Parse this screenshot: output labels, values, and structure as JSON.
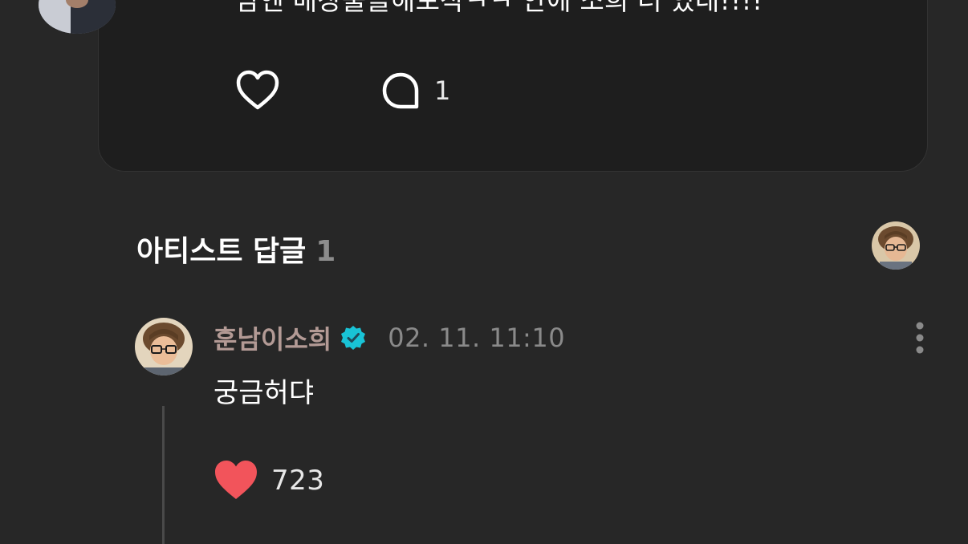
{
  "post": {
    "text": "담엔 매장출몰해보쟉ㅋㅋ 안에 소희 더 있대!!!!",
    "like_icon": "heart-outline-icon",
    "comment_icon": "comment-bubble-icon",
    "comment_count": "1"
  },
  "artist_replies": {
    "title": "아티스트 답글",
    "count": "1"
  },
  "reply": {
    "author": "훈남이소희",
    "verified_icon": "verified-badge-icon",
    "timestamp": "02. 11. 11:10",
    "text": "궁금허댜",
    "like_icon": "heart-filled-icon",
    "like_count": "723",
    "more_icon": "more-vertical-icon"
  },
  "colors": {
    "background": "#272727",
    "card": "#1e1e1e",
    "author_name": "#b39a95",
    "verified": "#19c3d6",
    "heart_filled": "#f2545b",
    "muted_text": "#8a8a8a"
  }
}
